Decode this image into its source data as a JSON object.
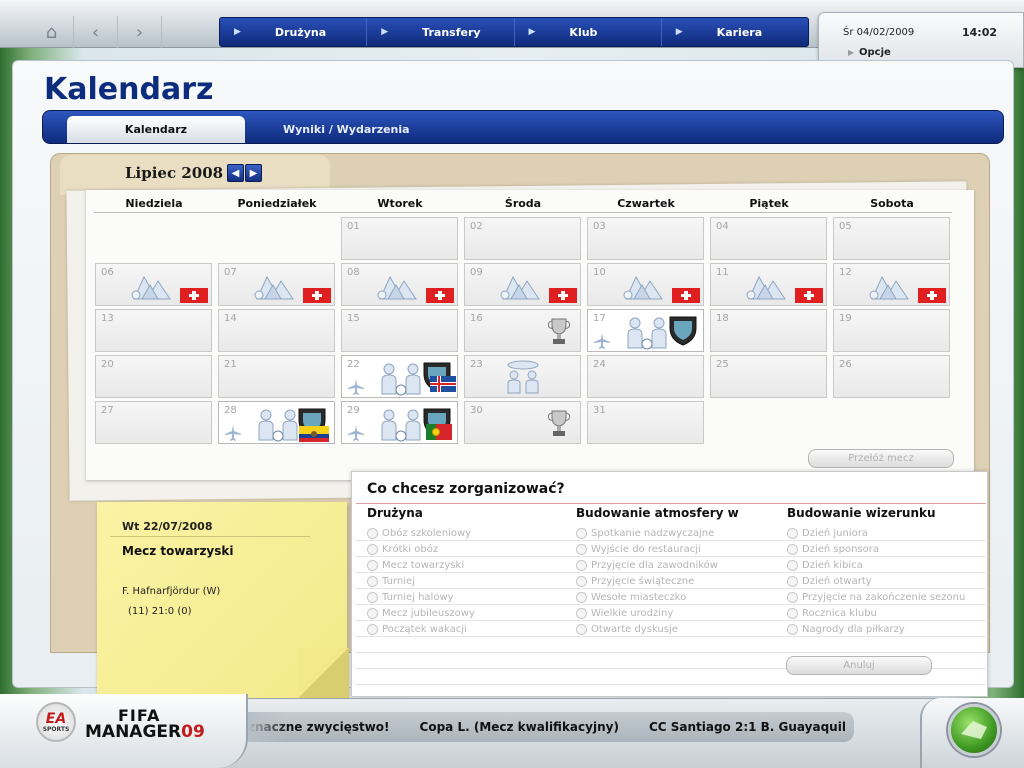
{
  "nav": {
    "items": [
      "Drużyna",
      "Transfery",
      "Klub",
      "Kariera"
    ]
  },
  "status": {
    "date": "Śr 04/02/2009",
    "time": "14:02",
    "options_label": "Opcje"
  },
  "page": {
    "title": "Kalendarz",
    "tabs": [
      "Kalendarz",
      "Wyniki / Wydarzenia"
    ]
  },
  "calendar": {
    "month": "Lipiec 2008",
    "weekdays": [
      "Niedziela",
      "Poniedziałek",
      "Wtorek",
      "Środa",
      "Czwartek",
      "Piątek",
      "Sobota"
    ],
    "reschedule_button": "Przełóż mecz",
    "days": [
      {
        "n": "01",
        "icons": []
      },
      {
        "n": "02",
        "icons": []
      },
      {
        "n": "03",
        "icons": []
      },
      {
        "n": "04",
        "icons": []
      },
      {
        "n": "05",
        "icons": []
      },
      {
        "n": "06",
        "icons": [
          "mountain-camp-icon",
          "swiss-flag-icon"
        ]
      },
      {
        "n": "07",
        "icons": [
          "mountain-camp-icon",
          "swiss-flag-icon"
        ]
      },
      {
        "n": "08",
        "icons": [
          "mountain-camp-icon",
          "swiss-flag-icon"
        ]
      },
      {
        "n": "09",
        "icons": [
          "mountain-camp-icon",
          "swiss-flag-icon"
        ]
      },
      {
        "n": "10",
        "icons": [
          "mountain-camp-icon",
          "swiss-flag-icon"
        ]
      },
      {
        "n": "11",
        "icons": [
          "mountain-camp-icon",
          "swiss-flag-icon"
        ]
      },
      {
        "n": "12",
        "icons": [
          "mountain-camp-icon",
          "swiss-flag-icon"
        ]
      },
      {
        "n": "13",
        "icons": []
      },
      {
        "n": "14",
        "icons": []
      },
      {
        "n": "15",
        "icons": []
      },
      {
        "n": "16",
        "icons": [
          "trophy-icon"
        ]
      },
      {
        "n": "17",
        "icons": [
          "plane-icon",
          "friendly-match-icon",
          "club-crest-icon"
        ]
      },
      {
        "n": "18",
        "icons": []
      },
      {
        "n": "19",
        "icons": []
      },
      {
        "n": "20",
        "icons": []
      },
      {
        "n": "21",
        "icons": []
      },
      {
        "n": "22",
        "icons": [
          "plane-icon",
          "friendly-match-icon",
          "club-crest-icon",
          "iceland-flag-icon"
        ]
      },
      {
        "n": "23",
        "icons": [
          "meeting-icon"
        ]
      },
      {
        "n": "24",
        "icons": []
      },
      {
        "n": "25",
        "icons": []
      },
      {
        "n": "26",
        "icons": []
      },
      {
        "n": "27",
        "icons": []
      },
      {
        "n": "28",
        "icons": [
          "plane-icon",
          "friendly-match-icon",
          "club-crest-icon",
          "ecuador-flag-icon"
        ]
      },
      {
        "n": "29",
        "icons": [
          "plane-icon",
          "friendly-match-icon",
          "club-crest-icon",
          "portugal-flag-icon"
        ]
      },
      {
        "n": "30",
        "icons": [
          "trophy-icon"
        ]
      },
      {
        "n": "31",
        "icons": []
      }
    ]
  },
  "note": {
    "date": "Wt 22/07/2008",
    "title": "Mecz towarzyski",
    "team": "F. Hafnarfjördur (W)",
    "score": "(11) 21:0 (0)"
  },
  "organize": {
    "title": "Co chcesz zorganizować?",
    "columns": [
      {
        "header": "Drużyna",
        "options": [
          "Obóz szkoleniowy",
          "Krótki obóz",
          "Mecz towarzyski",
          "Turniej",
          "Turniej halowy",
          "Mecz jubileuszowy",
          "Początek wakacji"
        ]
      },
      {
        "header": "Budowanie atmosfery w",
        "options": [
          "Spotkanie nadzwyczajne",
          "Wyjście do restauracji",
          "Przyjęcie dla zawodników",
          "Przyjęcie świąteczne",
          "Wesołe miasteczko",
          "Wielkie urodziny",
          "Otwarte dyskusje"
        ]
      },
      {
        "header": "Budowanie wizerunku",
        "options": [
          "Dzień juniora",
          "Dzień sponsora",
          "Dzień kibica",
          "Dzień otwarty",
          "Przyjęcie na zakończenie sezonu",
          "Rocznica klubu",
          "Nagrody dla piłkarzy"
        ]
      }
    ],
    "cancel_button": "Anuluj"
  },
  "ticker": {
    "items": [
      "znaczne zwycięstwo!",
      "Copa L. (Mecz kwalifikacyjny)",
      "CC Santiago 2:1 B. Guayaquil"
    ]
  },
  "brand": {
    "ea": "EA",
    "sports": "SPORTS",
    "line1": "FIFA",
    "line2": "MANAGER",
    "year": "09"
  },
  "colors": {
    "nav_blue": "#1a3c9e",
    "title_blue": "#0c2d7d",
    "continue_green": "#3f9a23"
  }
}
